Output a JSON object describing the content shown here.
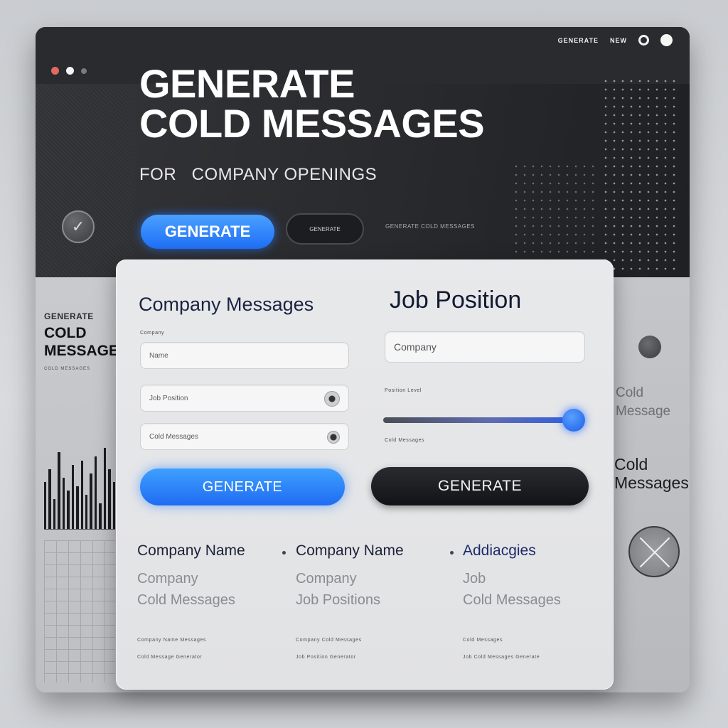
{
  "window": {
    "top_right_word": "GENERATE",
    "top_right_small": "NEW"
  },
  "hero": {
    "title_line1": "Generate",
    "title_line2": "Cold Messages",
    "subtitle": "For   Company Openings",
    "primary_button": "Generate",
    "secondary_button": "GENERATE",
    "small_caption": "GENERATE COLD MESSAGES"
  },
  "left_panel": {
    "small": "GENERATE",
    "big_line1": "COLD",
    "big_line2": "MESSAGE",
    "tiny": "COLD MESSAGES"
  },
  "right_panel": {
    "ghost_line1": "Cold",
    "ghost_line2": "Message",
    "cold_line1": "Cold",
    "cold_line2": "Messages"
  },
  "card": {
    "heading_left": "Company Messages",
    "heading_right": "Job Position",
    "left_fields": [
      {
        "label": "Company",
        "value": "Name"
      },
      {
        "label": "",
        "value": "Job Position"
      },
      {
        "label": "",
        "value": "Cold Messages"
      }
    ],
    "right_field": {
      "value": "Company"
    },
    "slider_label": "Position Level",
    "slider_caption": "Cold Messages",
    "generate_blue": "Generate",
    "generate_dark": "Generate",
    "columns": [
      {
        "head": "Company Name",
        "sub1": "Company",
        "sub2": "Cold Messages",
        "tiny1": "Company Name Messages",
        "tiny2": "Cold Message Generator"
      },
      {
        "head": "Company Name",
        "sub1": "Company",
        "sub2": "Job Positions",
        "tiny1": "Company Cold Messages",
        "tiny2": "Job Position Generator"
      },
      {
        "head": "Addiacgies",
        "sub1": "Job",
        "sub2": "Cold Messages",
        "tiny1": "Cold Messages",
        "tiny2": "Job Cold Messages Generate"
      }
    ]
  },
  "colors": {
    "accent_blue": "#1f6ef5",
    "dark_button": "#121317",
    "hero_bg": "#2b2c2f"
  },
  "chart_bars": [
    0.55,
    0.7,
    0.35,
    0.9,
    0.6,
    0.45,
    0.75,
    0.5,
    0.8,
    0.4,
    0.65,
    0.85,
    0.3,
    0.95,
    0.7,
    0.55
  ]
}
